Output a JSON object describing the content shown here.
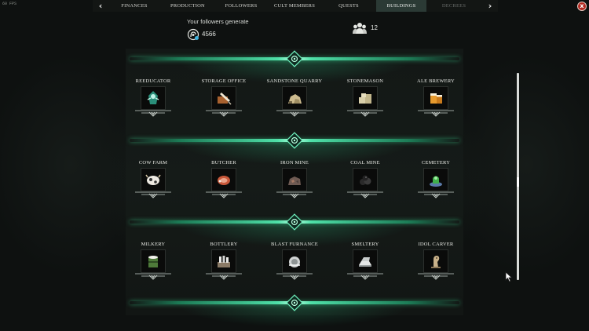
{
  "fps": "60 FPS",
  "nav": {
    "tabs": [
      {
        "label": "FINANCES",
        "state": "normal"
      },
      {
        "label": "PRODUCTION",
        "state": "normal"
      },
      {
        "label": "FOLLOWERS",
        "state": "normal"
      },
      {
        "label": "CULT MEMBERS",
        "state": "normal"
      },
      {
        "label": "QUESTS",
        "state": "normal"
      },
      {
        "label": "BUILDINGS",
        "state": "active"
      },
      {
        "label": "DECREES",
        "state": "disabled"
      }
    ],
    "prev_icon": "chevron-left-icon",
    "next_icon": "chevron-right-icon",
    "close_label": "x"
  },
  "header": {
    "generate_label": "Your followers generate",
    "generate_value": "4566",
    "generate_icon": "faith-icon",
    "followers_count": "12",
    "followers_icon": "followers-icon"
  },
  "buildings": [
    {
      "label": "REEDUCATOR",
      "icon": "reeducator-icon"
    },
    {
      "label": "STORAGE OFFICE",
      "icon": "storage-office-icon"
    },
    {
      "label": "SANDSTONE QUARRY",
      "icon": "sandstone-quarry-icon"
    },
    {
      "label": "STONEMASON",
      "icon": "stonemason-icon"
    },
    {
      "label": "ALE BREWERY",
      "icon": "ale-brewery-icon"
    },
    {
      "label": "COW FARM",
      "icon": "cow-farm-icon"
    },
    {
      "label": "BUTCHER",
      "icon": "butcher-icon"
    },
    {
      "label": "IRON MINE",
      "icon": "iron-mine-icon"
    },
    {
      "label": "COAL MINE",
      "icon": "coal-mine-icon"
    },
    {
      "label": "CEMETERY",
      "icon": "cemetery-icon"
    },
    {
      "label": "MILKERY",
      "icon": "milkery-icon"
    },
    {
      "label": "BOTTLERY",
      "icon": "bottlery-icon"
    },
    {
      "label": "BLAST FURNANCE",
      "icon": "blast-furnance-icon"
    },
    {
      "label": "SMELTERY",
      "icon": "smeltery-icon"
    },
    {
      "label": "IDOL CARVER",
      "icon": "idol-carver-icon"
    }
  ],
  "colors": {
    "accent_green": "#4fe0a8",
    "active_tab": "#2b3a35",
    "close_red": "#b32a22"
  }
}
